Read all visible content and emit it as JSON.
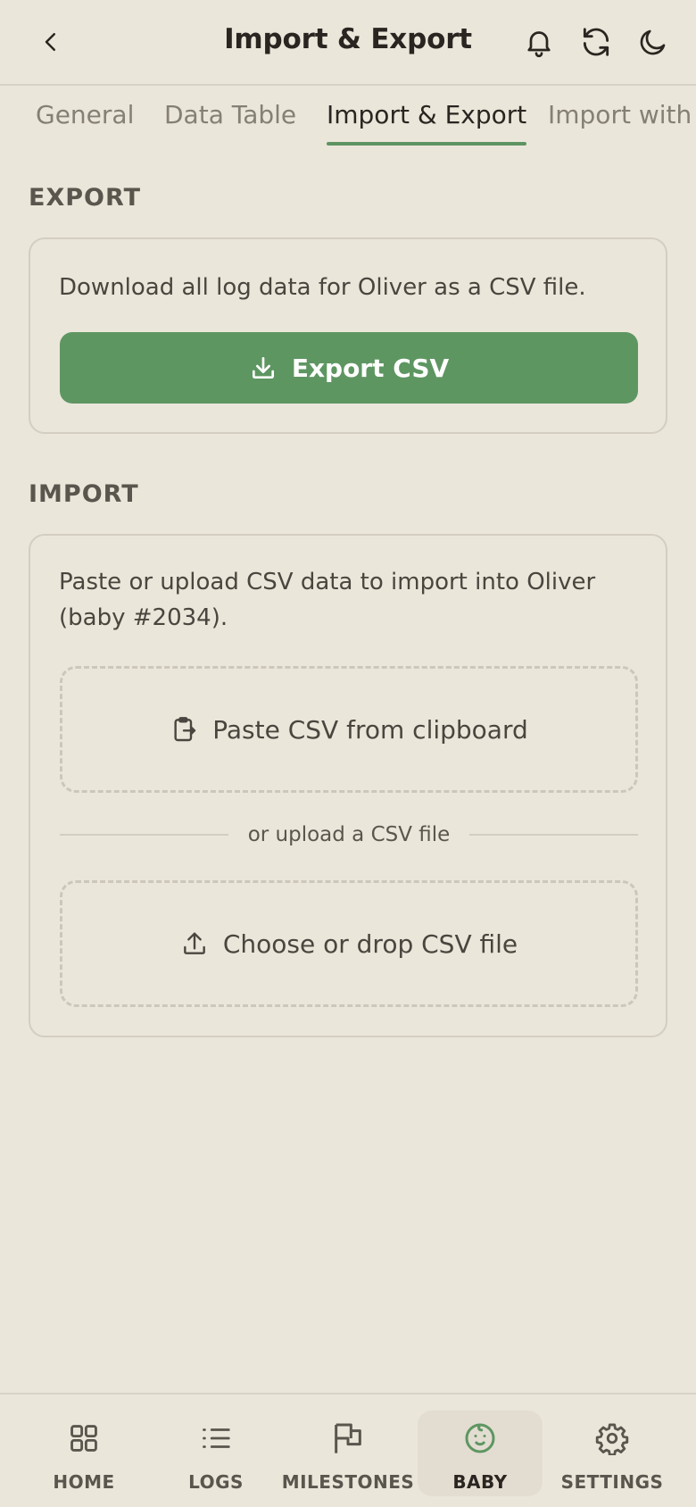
{
  "header": {
    "title": "Import & Export",
    "back_icon": "chevron-left-icon",
    "icons": [
      "bell-icon",
      "refresh-icon",
      "moon-icon"
    ]
  },
  "tabs": [
    {
      "label": "General",
      "active": false
    },
    {
      "label": "Data Table",
      "active": false
    },
    {
      "label": "Import & Export",
      "active": true
    },
    {
      "label": "Import with AI",
      "active": false
    }
  ],
  "export": {
    "heading": "EXPORT",
    "description": "Download all log data for Oliver as a CSV file.",
    "button_label": "Export CSV",
    "button_icon": "download-icon"
  },
  "import": {
    "heading": "IMPORT",
    "description_line1": "Paste or upload CSV data to import into Oliver",
    "description_line2": "(baby #2034).",
    "paste_label": "Paste CSV from clipboard",
    "paste_icon": "clipboard-icon",
    "divider_text": "or upload a CSV file",
    "upload_label": "Choose or drop CSV file",
    "upload_icon": "upload-icon"
  },
  "bottom_nav": [
    {
      "label": "HOME",
      "icon": "grid-icon",
      "active": false
    },
    {
      "label": "LOGS",
      "icon": "list-icon",
      "active": false
    },
    {
      "label": "MILESTONES",
      "icon": "flag-icon",
      "active": false
    },
    {
      "label": "BABY",
      "icon": "baby-face-icon",
      "active": true
    },
    {
      "label": "SETTINGS",
      "icon": "gear-icon",
      "active": false
    }
  ],
  "colors": {
    "background": "#ebe6da",
    "accent": "#5e9662",
    "text": "#2a2520"
  }
}
